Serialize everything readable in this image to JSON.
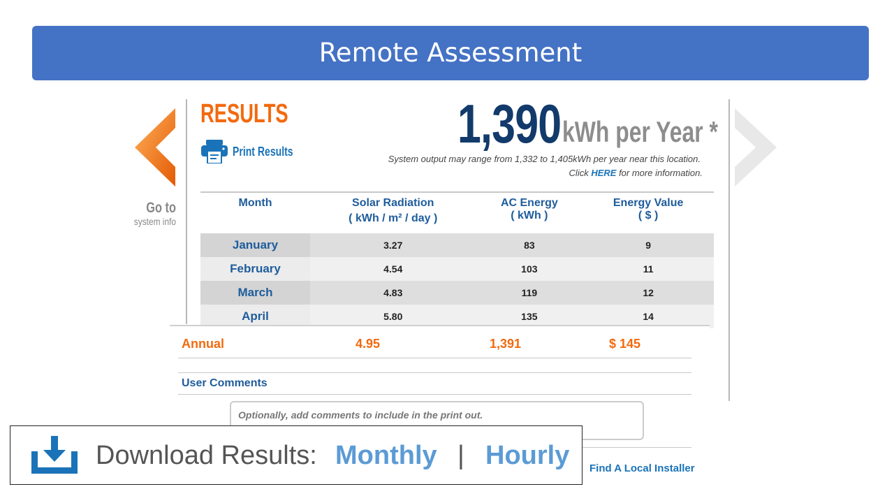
{
  "banner": {
    "title": "Remote Assessment"
  },
  "nav": {
    "go_to": "Go to",
    "system_info": "system info"
  },
  "results": {
    "title": "RESULTS",
    "print_label": "Print Results",
    "annual_output": "1,390",
    "unit": "kWh per Year *",
    "range_note": "System output may range from 1,332 to 1,405kWh per year near this location.",
    "click_prefix": "Click ",
    "click_link": "HERE",
    "click_suffix": " for more information."
  },
  "table": {
    "headers": [
      {
        "line1": "Month",
        "line2": ""
      },
      {
        "line1": "Solar Radiation",
        "line2": "( kWh / m² / day )"
      },
      {
        "line1": "AC Energy",
        "line2": "( kWh )"
      },
      {
        "line1": "Energy Value",
        "line2": "( $ )"
      }
    ],
    "rows": [
      {
        "month": "January",
        "solar": "3.27",
        "ac": "83",
        "value": "9"
      },
      {
        "month": "February",
        "solar": "4.54",
        "ac": "103",
        "value": "11"
      },
      {
        "month": "March",
        "solar": "4.83",
        "ac": "119",
        "value": "12"
      },
      {
        "month": "April",
        "solar": "5.80",
        "ac": "135",
        "value": "14"
      }
    ],
    "annual": {
      "label": "Annual",
      "solar": "4.95",
      "ac": "1,391",
      "value": "$ 145"
    }
  },
  "comments": {
    "title": "User Comments",
    "placeholder": "Optionally, add comments to include in the print out."
  },
  "installer": "Find A Local Installer",
  "download": {
    "label": "Download Results:",
    "monthly": "Monthly",
    "separator": "|",
    "hourly": "Hourly"
  },
  "colors": {
    "banner": "#4472c4",
    "accent_orange": "#f26a0f",
    "link_blue": "#1a73b8",
    "header_blue": "#1e5c9c",
    "download_blue": "#5b9bd5"
  }
}
